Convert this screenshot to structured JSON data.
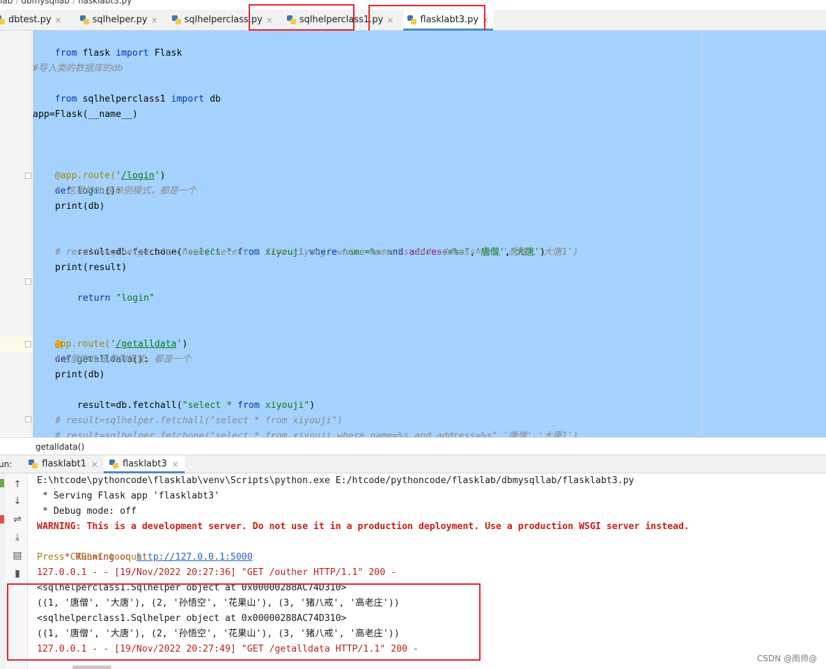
{
  "breadcrumb": [
    "lab",
    "dbmysqllab",
    "flasklabt3.py"
  ],
  "editor_tabs": [
    {
      "label": "dbtest.py",
      "close": "×"
    },
    {
      "label": "sqlhelper.py",
      "close": "×"
    },
    {
      "label": "sqlhelperclass.py",
      "close": "×"
    },
    {
      "label": "sqlhelperclass1.py",
      "close": "×"
    },
    {
      "label": "flasklabt3.py",
      "close": "×"
    }
  ],
  "code": {
    "l1": {
      "a": "from",
      "b": " flask ",
      "c": "import",
      "d": " Flask"
    },
    "l2": "#导入类的数据库的db",
    "l3": {
      "a": "from",
      "b": " sqlhelperclass1 ",
      "c": "import",
      "d": " db"
    },
    "l4": "app=Flask(__name__)",
    "l5": {
      "a": "@app.route(",
      "b": "'",
      "c": "/login",
      "d": "'",
      "e": ")"
    },
    "l6": {
      "a": "def",
      "b": " ",
      "c": "login",
      "d": "():"
    },
    "l7": "# 这里的db是单例模式，都是一个",
    "l8": "print(db)",
    "l9": {
      "a": "result=db.fetchone(",
      "b": "\"select * ",
      "c": "from",
      "d": " xiyouji ",
      "e": "where",
      "f": " name=%s ",
      "g": "and",
      "h": " ",
      "i": "address",
      "j": "=%s\"",
      "k": ",",
      "l": "'唐僧'",
      "m": ",",
      "n": "'大唐'",
      "o": ")"
    },
    "l10": "# result=sqlhelper.fetchone(\"select * from xiyouji where name=%s and address=%s\",'唐僧','大唐1')",
    "l11": "print(result)",
    "l12": {
      "a": "return",
      "b": " ",
      "c": "\"login\""
    },
    "l13": {
      "a": "@",
      "b": "pp.route(",
      "c": "'",
      "d": "/getalldata",
      "e": "'",
      "f": ")"
    },
    "l14": {
      "a": "def",
      "b": " ",
      "c": "getalldata",
      "d": "():"
    },
    "l15": "#这里的db是单例模式，都是一个",
    "l16": "print(db)",
    "l17": {
      "a": "result=db.fetchall(",
      "b": "\"select * ",
      "c": "from",
      "d": " xiyouji\"",
      "e": ")"
    },
    "l18": "# result=sqlhelper.fetchall(\"select * from xiyouji\")",
    "l19": "# result=sqlhelper.fetchone(\"select * from xiyouji where name=%s and address=%s\",'唐僧','大唐1')"
  },
  "editor_breadcrumb": "getalldata()",
  "run": {
    "label": "un:",
    "tabs": [
      {
        "label": "flasklabt1",
        "close": "×"
      },
      {
        "label": "flasklabt3",
        "close": "×"
      }
    ]
  },
  "console": {
    "l1": "E:\\htcode\\pythoncode\\flasklab\\venv\\Scripts\\python.exe E:/htcode/pythoncode/flasklab/dbmysqllab/flasklabt3.py",
    "l2": " * Serving Flask app 'flasklabt3'",
    "l3": " * Debug mode: off",
    "l4": "WARNING: This is a development server. Do not use it in a production deployment. Use a production WSGI server instead.",
    "l5a": " * Running on ",
    "l5b": "http://127.0.0.1:5000",
    "l6": "Press CTRL+C to quit",
    "l7": "127.0.0.1 - - [19/Nov/2022 20:27:36] \"GET /outher HTTP/1.1\" 200 -",
    "l8": "<sqlhelperclass1.Sqlhelper object at 0x00000288AC74D310>",
    "l9": "((1, '唐僧', '大唐'), (2, '孙悟空', '花果山'), (3, '猪八戒', '高老庄'))",
    "l10": "<sqlhelperclass1.Sqlhelper object at 0x00000288AC74D310>",
    "l11": "((1, '唐僧', '大唐'), (2, '孙悟空', '花果山'), (3, '猪八戒', '高老庄'))",
    "l12": "127.0.0.1 - - [19/Nov/2022 20:27:49] \"GET /getalldata HTTP/1.1\" 200 -"
  },
  "toolbar_icons": [
    "up-arrow-icon",
    "down-arrow-icon",
    "soft-wrap-icon",
    "scroll-to-end-icon",
    "print-icon",
    "trash-icon"
  ],
  "watermark": "CSDN @雨师@",
  "colors": {
    "selection": "#a6d2ff",
    "keyword": "#0033b3",
    "string": "#067d17",
    "comment": "#8c8c8c",
    "warning": "#c81e17",
    "annotation_box": "#e8202a"
  }
}
